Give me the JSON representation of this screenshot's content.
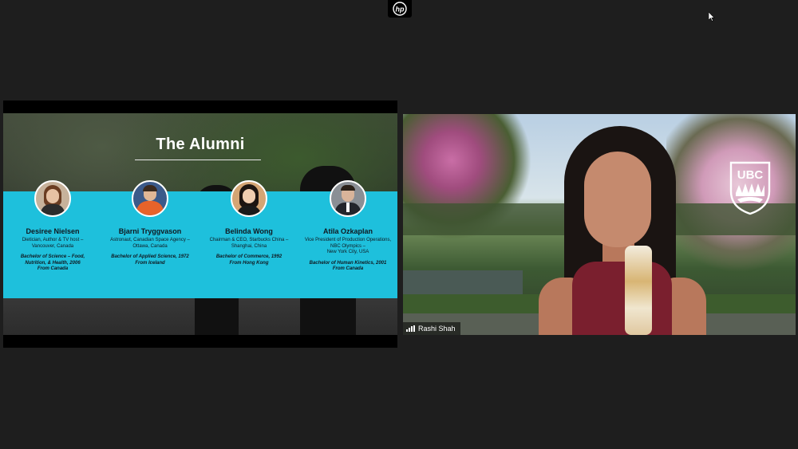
{
  "top_bar": {
    "logo_text": "hp"
  },
  "shared_slide": {
    "title": "The Alumni",
    "alumni": [
      {
        "name": "Desiree Nielsen",
        "role_lines": [
          "Dietician, Author & TV host –",
          "Vancouver, Canada"
        ],
        "degree_lines": [
          "Bachelor of Science – Food,",
          "Nutrition, & Health, 2006",
          "From Canada"
        ]
      },
      {
        "name": "Bjarni Tryggvason",
        "role_lines": [
          "Astronaut, Canadian Space Agency –",
          "Ottawa, Canada"
        ],
        "degree_lines": [
          "Bachelor of Applied Science, 1972",
          "From Iceland"
        ]
      },
      {
        "name": "Belinda Wong",
        "role_lines": [
          "Chairman & CEO, Starbucks China –",
          "Shanghai, China"
        ],
        "degree_lines": [
          "Bachelor of Commerce, 1992",
          "From Hong Kong"
        ]
      },
      {
        "name": "Atila Ozkaplan",
        "role_lines": [
          "Vice President of Production Operations,",
          "NBC Olympics –",
          "New York City, USA"
        ],
        "degree_lines": [
          "Bachelor of Human Kinetics, 2001",
          "From Canada"
        ]
      }
    ]
  },
  "video_tile": {
    "participant_name": "Rashi Shah",
    "logo_text": "UBC"
  },
  "colors": {
    "background": "#1e1e1e",
    "slide_band": "#1ec0dc",
    "shirt": "#7a1f2e"
  }
}
